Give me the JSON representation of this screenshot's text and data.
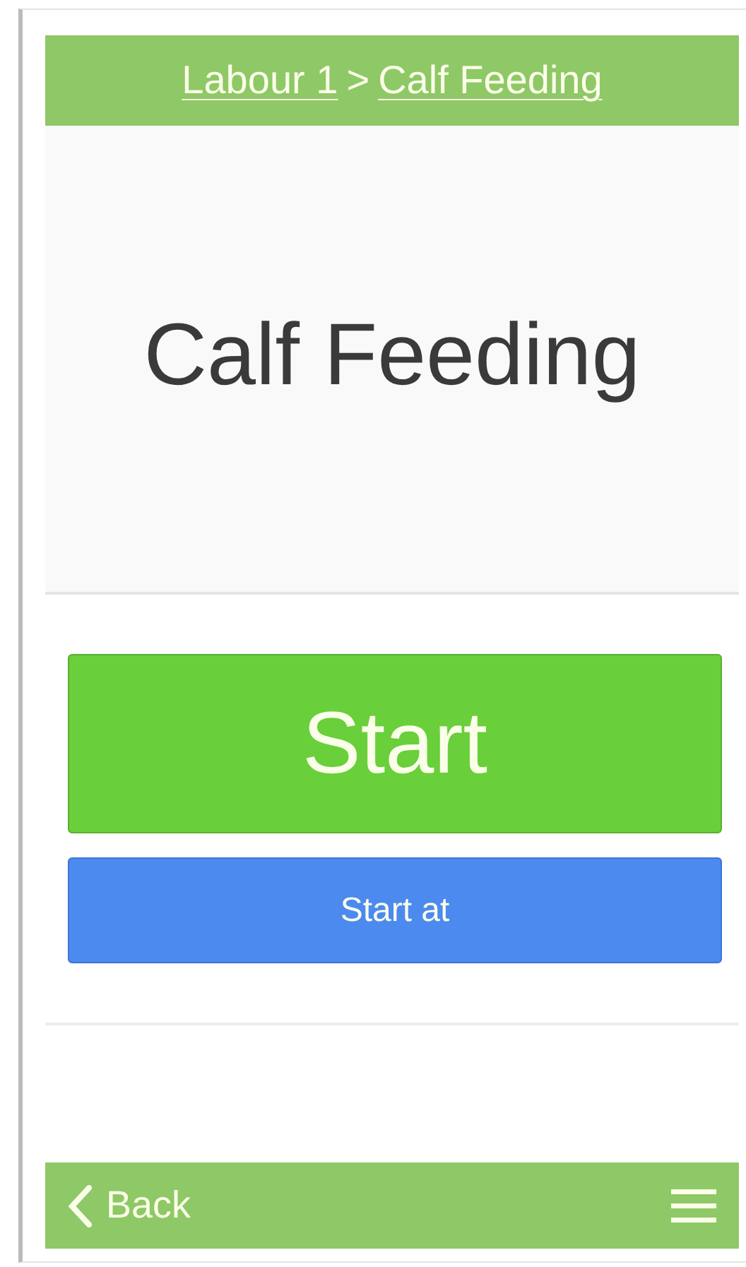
{
  "breadcrumb": {
    "items": [
      "Labour 1",
      "Calf Feeding"
    ],
    "separator": ">"
  },
  "title": "Calf Feeding",
  "buttons": [
    {
      "label": "Start",
      "kind": "primary"
    },
    {
      "label": "Start at",
      "kind": "secondary"
    }
  ],
  "footer": {
    "back": "Back"
  }
}
